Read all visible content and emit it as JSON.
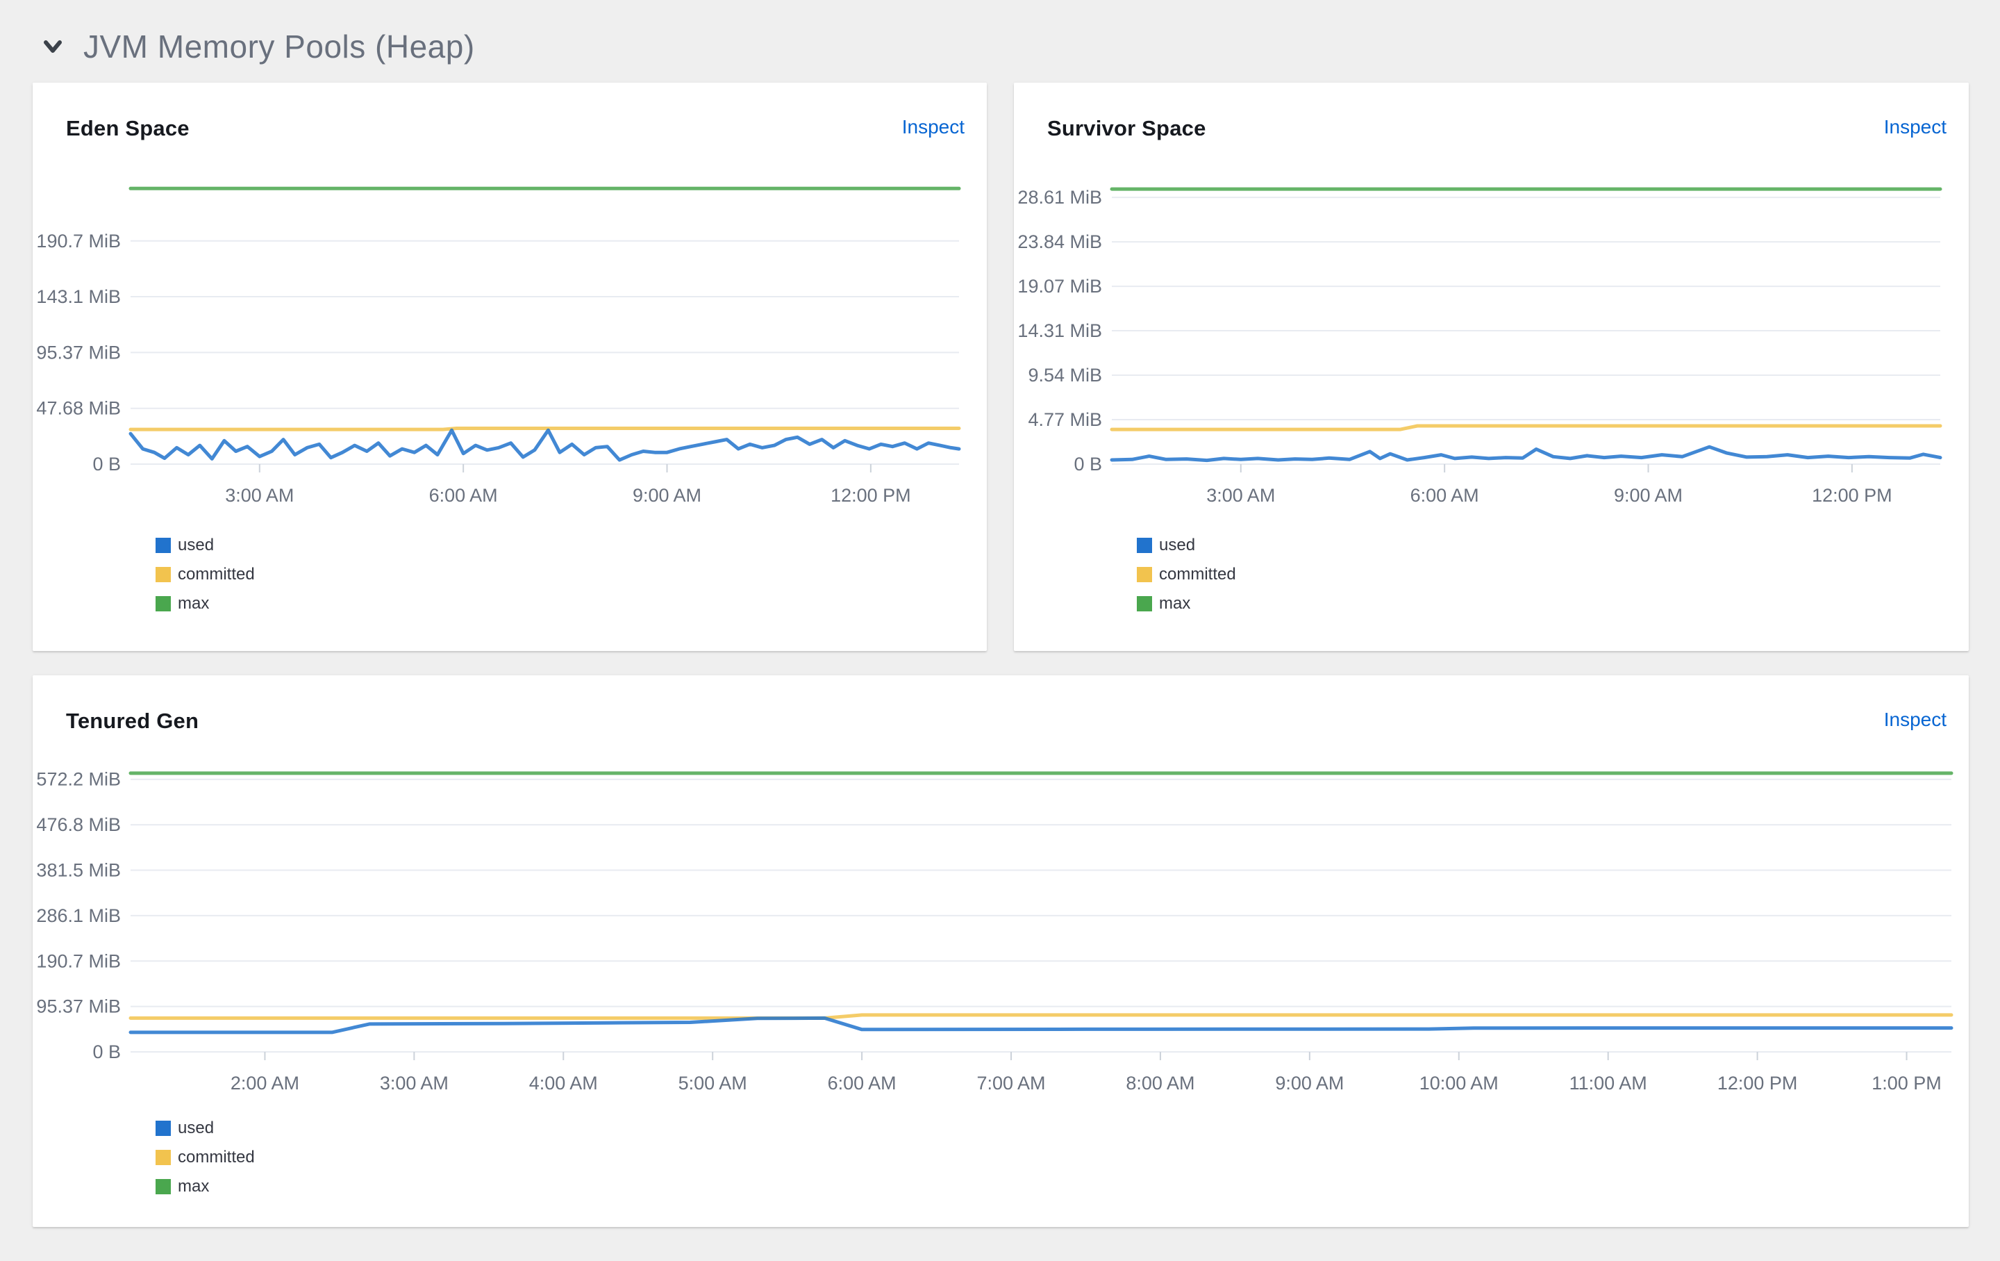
{
  "section": {
    "title": "JVM Memory Pools (Heap)"
  },
  "ui": {
    "inspect_label": "Inspect"
  },
  "colors": {
    "used": "#2173cd",
    "committed": "#f2c34e",
    "max": "#4aa74e",
    "link": "#0765d2",
    "axis_text": "#69707d",
    "gridline": "#e8ebf1",
    "tick": "#ccd2da",
    "section_title": "#69707d",
    "card_title": "#16191f",
    "page_background": "#efefef",
    "card_background": "#ffffff"
  },
  "chart_data": [
    {
      "type": "line",
      "title": "Eden Space",
      "inspect_label": "Inspect",
      "grid": "horizontal",
      "legend_position": "bottom-left",
      "x_unit": "time",
      "x_range": [
        1.1,
        13.3
      ],
      "ylim": [
        0,
        236.3
      ],
      "y_ticks": [
        {
          "v": 0,
          "label": "0 B"
        },
        {
          "v": 47.68,
          "label": "47.68 MiB"
        },
        {
          "v": 95.37,
          "label": "95.37 MiB"
        },
        {
          "v": 143.1,
          "label": "143.1 MiB"
        },
        {
          "v": 190.7,
          "label": "190.7 MiB"
        }
      ],
      "x_ticks": [
        {
          "h": 3,
          "label": "3:00 AM"
        },
        {
          "h": 6,
          "label": "6:00 AM"
        },
        {
          "h": 9,
          "label": "9:00 AM"
        },
        {
          "h": 12,
          "label": "12:00 PM"
        }
      ],
      "series": [
        {
          "name": "max",
          "color": "#4aa74e",
          "points": [
            [
              1.1,
              235.5
            ],
            [
              13.3,
              235.5
            ]
          ]
        },
        {
          "name": "committed",
          "color": "#f2c34e",
          "points": [
            [
              1.1,
              29.6
            ],
            [
              5.7,
              29.6
            ],
            [
              5.9,
              30.6
            ],
            [
              13.3,
              30.6
            ]
          ]
        },
        {
          "name": "used",
          "color": "#2173cd",
          "points": [
            [
              1.1,
              26
            ],
            [
              1.28,
              13
            ],
            [
              1.45,
              10
            ],
            [
              1.6,
              5
            ],
            [
              1.78,
              14
            ],
            [
              1.95,
              8
            ],
            [
              2.12,
              16
            ],
            [
              2.3,
              4.5
            ],
            [
              2.48,
              20
            ],
            [
              2.65,
              11
            ],
            [
              2.82,
              15
            ],
            [
              3.0,
              6.5
            ],
            [
              3.18,
              11
            ],
            [
              3.35,
              21
            ],
            [
              3.52,
              8
            ],
            [
              3.7,
              14
            ],
            [
              3.88,
              17
            ],
            [
              4.05,
              5.5
            ],
            [
              4.22,
              10
            ],
            [
              4.4,
              16
            ],
            [
              4.58,
              11
            ],
            [
              4.75,
              18
            ],
            [
              4.92,
              7
            ],
            [
              5.1,
              13
            ],
            [
              5.28,
              10
            ],
            [
              5.45,
              16
            ],
            [
              5.62,
              8
            ],
            [
              5.83,
              29
            ],
            [
              6.0,
              9
            ],
            [
              6.18,
              16
            ],
            [
              6.35,
              12
            ],
            [
              6.52,
              14
            ],
            [
              6.7,
              18
            ],
            [
              6.88,
              6
            ],
            [
              7.05,
              12
            ],
            [
              7.25,
              29
            ],
            [
              7.42,
              10
            ],
            [
              7.6,
              17
            ],
            [
              7.78,
              8
            ],
            [
              7.95,
              14
            ],
            [
              8.12,
              15
            ],
            [
              8.3,
              3.5
            ],
            [
              8.48,
              8
            ],
            [
              8.65,
              11
            ],
            [
              8.82,
              10
            ],
            [
              9.0,
              10
            ],
            [
              9.18,
              13
            ],
            [
              9.35,
              15
            ],
            [
              9.52,
              17
            ],
            [
              9.7,
              19
            ],
            [
              9.88,
              21
            ],
            [
              10.05,
              13
            ],
            [
              10.22,
              17
            ],
            [
              10.4,
              14
            ],
            [
              10.58,
              16
            ],
            [
              10.75,
              21
            ],
            [
              10.92,
              23
            ],
            [
              11.1,
              17
            ],
            [
              11.28,
              21
            ],
            [
              11.45,
              14
            ],
            [
              11.62,
              20
            ],
            [
              11.8,
              16
            ],
            [
              11.98,
              13
            ],
            [
              12.15,
              17
            ],
            [
              12.32,
              15
            ],
            [
              12.5,
              18
            ],
            [
              12.68,
              13
            ],
            [
              12.85,
              18
            ],
            [
              13.02,
              16
            ],
            [
              13.18,
              14
            ],
            [
              13.3,
              13
            ]
          ]
        }
      ],
      "legend": [
        "used",
        "committed",
        "max"
      ]
    },
    {
      "type": "line",
      "title": "Survivor Space",
      "inspect_label": "Inspect",
      "grid": "horizontal",
      "legend_position": "bottom-left",
      "x_unit": "time",
      "x_range": [
        1.1,
        13.3
      ],
      "ylim": [
        0,
        29.66
      ],
      "y_ticks": [
        {
          "v": 0,
          "label": "0 B"
        },
        {
          "v": 4.77,
          "label": "4.77 MiB"
        },
        {
          "v": 9.54,
          "label": "9.54 MiB"
        },
        {
          "v": 14.31,
          "label": "14.31 MiB"
        },
        {
          "v": 19.07,
          "label": "19.07 MiB"
        },
        {
          "v": 23.84,
          "label": "23.84 MiB"
        },
        {
          "v": 28.61,
          "label": "28.61 MiB"
        }
      ],
      "x_ticks": [
        {
          "h": 3,
          "label": "3:00 AM"
        },
        {
          "h": 6,
          "label": "6:00 AM"
        },
        {
          "h": 9,
          "label": "9:00 AM"
        },
        {
          "h": 12,
          "label": "12:00 PM"
        }
      ],
      "series": [
        {
          "name": "max",
          "color": "#4aa74e",
          "points": [
            [
              1.1,
              29.5
            ],
            [
              13.3,
              29.5
            ]
          ]
        },
        {
          "name": "committed",
          "color": "#f2c34e",
          "points": [
            [
              1.1,
              3.72
            ],
            [
              5.35,
              3.72
            ],
            [
              5.6,
              4.1
            ],
            [
              13.3,
              4.1
            ]
          ]
        },
        {
          "name": "used",
          "color": "#2173cd",
          "points": [
            [
              1.1,
              0.45
            ],
            [
              1.4,
              0.5
            ],
            [
              1.65,
              0.85
            ],
            [
              1.9,
              0.5
            ],
            [
              2.2,
              0.55
            ],
            [
              2.5,
              0.4
            ],
            [
              2.75,
              0.6
            ],
            [
              3.0,
              0.5
            ],
            [
              3.25,
              0.6
            ],
            [
              3.55,
              0.45
            ],
            [
              3.8,
              0.55
            ],
            [
              4.05,
              0.5
            ],
            [
              4.3,
              0.65
            ],
            [
              4.6,
              0.5
            ],
            [
              4.9,
              1.35
            ],
            [
              5.05,
              0.6
            ],
            [
              5.2,
              1.1
            ],
            [
              5.45,
              0.45
            ],
            [
              5.7,
              0.7
            ],
            [
              5.95,
              1.0
            ],
            [
              6.15,
              0.6
            ],
            [
              6.4,
              0.75
            ],
            [
              6.65,
              0.6
            ],
            [
              6.9,
              0.7
            ],
            [
              7.15,
              0.65
            ],
            [
              7.35,
              1.6
            ],
            [
              7.6,
              0.8
            ],
            [
              7.85,
              0.6
            ],
            [
              8.1,
              0.9
            ],
            [
              8.35,
              0.7
            ],
            [
              8.6,
              0.85
            ],
            [
              8.9,
              0.7
            ],
            [
              9.2,
              1.0
            ],
            [
              9.5,
              0.8
            ],
            [
              9.9,
              1.85
            ],
            [
              10.15,
              1.2
            ],
            [
              10.45,
              0.75
            ],
            [
              10.75,
              0.8
            ],
            [
              11.05,
              1.0
            ],
            [
              11.35,
              0.7
            ],
            [
              11.65,
              0.85
            ],
            [
              11.95,
              0.7
            ],
            [
              12.25,
              0.8
            ],
            [
              12.55,
              0.7
            ],
            [
              12.85,
              0.65
            ],
            [
              13.05,
              1.05
            ],
            [
              13.3,
              0.7
            ]
          ]
        }
      ],
      "legend": [
        "used",
        "committed",
        "max"
      ]
    },
    {
      "type": "line",
      "title": "Tenured Gen",
      "inspect_label": "Inspect",
      "grid": "horizontal",
      "legend_position": "bottom-left",
      "x_unit": "time",
      "x_range": [
        1.1,
        13.3
      ],
      "ylim": [
        0,
        584.9
      ],
      "y_ticks": [
        {
          "v": 0,
          "label": "0 B"
        },
        {
          "v": 95.37,
          "label": "95.37 MiB"
        },
        {
          "v": 190.7,
          "label": "190.7 MiB"
        },
        {
          "v": 286.1,
          "label": "286.1 MiB"
        },
        {
          "v": 381.5,
          "label": "381.5 MiB"
        },
        {
          "v": 476.8,
          "label": "476.8 MiB"
        },
        {
          "v": 572.2,
          "label": "572.2 MiB"
        }
      ],
      "x_ticks": [
        {
          "h": 2,
          "label": "2:00 AM"
        },
        {
          "h": 3,
          "label": "3:00 AM"
        },
        {
          "h": 4,
          "label": "4:00 AM"
        },
        {
          "h": 5,
          "label": "5:00 AM"
        },
        {
          "h": 6,
          "label": "6:00 AM"
        },
        {
          "h": 7,
          "label": "7:00 AM"
        },
        {
          "h": 8,
          "label": "8:00 AM"
        },
        {
          "h": 9,
          "label": "9:00 AM"
        },
        {
          "h": 10,
          "label": "10:00 AM"
        },
        {
          "h": 11,
          "label": "11:00 AM"
        },
        {
          "h": 12,
          "label": "12:00 PM"
        },
        {
          "h": 13,
          "label": "1:00 PM"
        }
      ],
      "series": [
        {
          "name": "max",
          "color": "#4aa74e",
          "points": [
            [
              1.1,
              585
            ],
            [
              13.3,
              585
            ]
          ]
        },
        {
          "name": "committed",
          "color": "#f2c34e",
          "points": [
            [
              1.1,
              70.9
            ],
            [
              5.75,
              70.9
            ],
            [
              6.0,
              77.5
            ],
            [
              13.3,
              77.5
            ]
          ]
        },
        {
          "name": "used",
          "color": "#2173cd",
          "points": [
            [
              1.1,
              41
            ],
            [
              2.45,
              41
            ],
            [
              2.7,
              58.5
            ],
            [
              3.6,
              59.5
            ],
            [
              4.3,
              61
            ],
            [
              4.85,
              62
            ],
            [
              5.3,
              70.3
            ],
            [
              5.75,
              70.9
            ],
            [
              6.0,
              47
            ],
            [
              7.5,
              47.5
            ],
            [
              9.8,
              48
            ],
            [
              10.1,
              50
            ],
            [
              13.3,
              50.2
            ]
          ]
        }
      ],
      "legend": [
        "used",
        "committed",
        "max"
      ]
    }
  ]
}
